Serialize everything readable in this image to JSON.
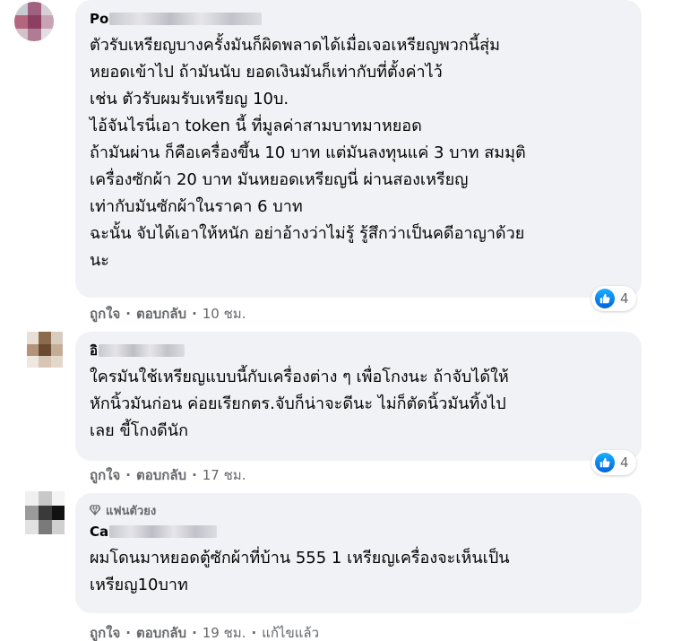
{
  "colors": {
    "bubble": "#f0f2f5",
    "meta": "#65676b",
    "like_blue": "#1877f2"
  },
  "comments": [
    {
      "author_visible": "Po",
      "body": "ตัวรับเหรียญบางครั้งมันก็ผิดพลาดได้เมื่อเจอเหรียญพวกนี้สุ่ม\nหยอดเข้าไป ถ้ามันนับ ยอดเงินมันก็เท่ากับที่ตั้งค่าไว้\nเช่น ตัวรับผมรับเหรียญ 10บ.\nไอ้จันไรนี่เอา token นี้ ที่มูลค่าสามบาทมาหยอด\nถ้ามันผ่าน ก็คือเครื่องขึ้น 10 บาท แต่มันลงทุนแค่ 3 บาท สมมุติ\nเครื่องซักผ้า 20 บาท มันหยอดเหรียญนี่ ผ่านสองเหรียญ\nเท่ากับมันซักผ้าในราคา 6 บาท\nฉะนั้น จับได้เอาให้หนัก อย่าอ้างว่าไม่รู้ รู้สึกว่าเป็นคดีอาญาด้วย\nนะ",
      "reaction_icon": "like-icon",
      "reaction_count": "4",
      "like_label": "ถูกใจ",
      "reply_label": "ตอบกลับ",
      "time": "10 ชม."
    },
    {
      "author_visible": "อิ",
      "body": "ใครมันใช้เหรียญแบบนี้กับเครื่องต่าง ๆ เพื่อโกงนะ ถ้าจับได้ให้\nหักนิ้วมันก่อน ค่อยเรียกตร.จับก็น่าจะดีนะ ไม่ก็ตัดนิ้วมันทิ้งไป\nเลย ขี้โกงดีนัก",
      "reaction_icon": "like-icon",
      "reaction_count": "4",
      "like_label": "ถูกใจ",
      "reply_label": "ตอบกลับ",
      "time": "17 ชม."
    },
    {
      "badge_icon": "diamond-icon",
      "badge": "แฟนตัวยง",
      "author_visible": "Ca",
      "body": "ผมโดนมาหยอดตู้ซักผ้าที่บ้าน 555 1 เหรียญเครื่องจะเห็นเป็น\nเหรียญ10บาท",
      "like_label": "ถูกใจ",
      "reply_label": "ตอบกลับ",
      "time": "19 ชม.",
      "edited": "แก้ไขแล้ว"
    }
  ]
}
